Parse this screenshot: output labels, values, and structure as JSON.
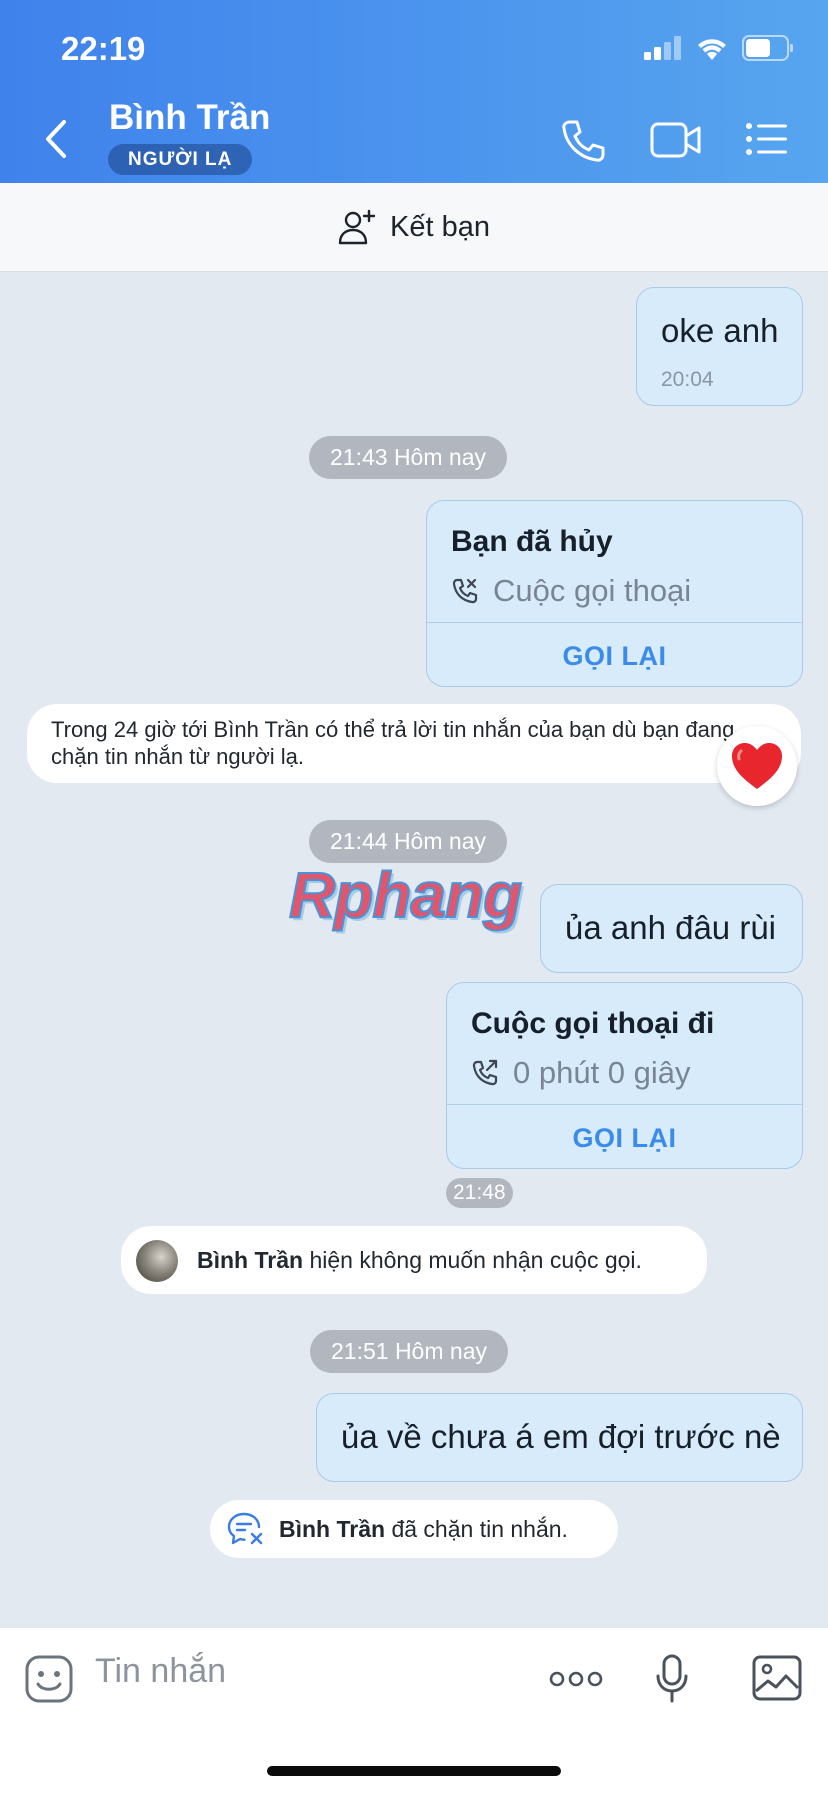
{
  "status_bar": {
    "time": "22:19"
  },
  "header": {
    "title": "Bình Trần",
    "badge": "NGƯỜI LẠ"
  },
  "add_friend": {
    "label": "Kết bạn"
  },
  "messages": {
    "m1": {
      "text": "oke anh",
      "time": "20:04"
    },
    "pill1": "21:43 Hôm nay",
    "call1": {
      "title": "Bạn đã hủy",
      "subtitle": "Cuộc gọi thoại",
      "action": "GỌI LẠI"
    },
    "notice": "Trong 24 giờ tới Bình Trần có thể trả lời tin nhắn của bạn dù bạn đang chặn tin nhắn từ người lạ.",
    "pill2": "21:44 Hôm nay",
    "m2": {
      "text": "ủa anh đâu rùi"
    },
    "call2": {
      "title": "Cuộc gọi thoại đi",
      "subtitle": "0 phút 0 giây",
      "action": "GỌI LẠI",
      "time": "21:48"
    },
    "sys1": {
      "name": "Bình Trần",
      "text": " hiện không muốn nhận cuộc gọi."
    },
    "pill3": "21:51 Hôm nay",
    "m3": {
      "text": "ủa về chưa á em đợi trước nè"
    },
    "sys2": {
      "name": "Bình Trần",
      "text": " đã chặn tin nhắn."
    }
  },
  "watermark": "Rphang",
  "composer": {
    "placeholder": "Tin nhắn"
  },
  "colors": {
    "header_start": "#3f82ec",
    "header_end": "#57a5ef",
    "bubble": "#d7ebfa",
    "chat_bg": "#e2e9f1",
    "action_blue": "#3a8bea",
    "heart": "#e8262e"
  }
}
